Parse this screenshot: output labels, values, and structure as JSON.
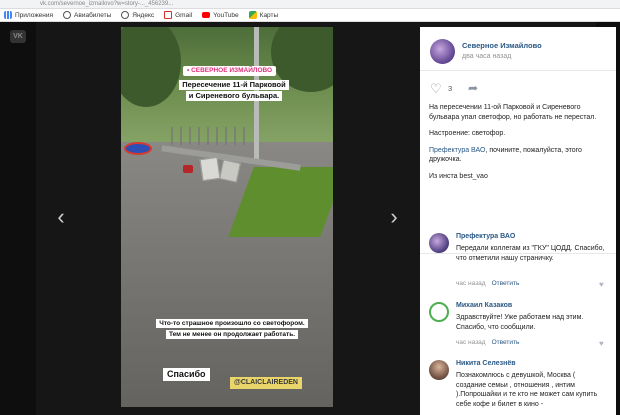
{
  "browser": {
    "url": "vk.com/severnoe_izmailovo?w=story-..._456239...",
    "bookmarks": [
      {
        "label": "Приложения",
        "icon": "apps-grid-icon",
        "color": "#4285f4"
      },
      {
        "label": "Авиабилеты",
        "icon": "globe-icon",
        "color": "#555555"
      },
      {
        "label": "Яндекс",
        "icon": "globe-icon",
        "color": "#555555"
      },
      {
        "label": "Gmail",
        "icon": "gmail-icon",
        "color": "#d93025"
      },
      {
        "label": "YouTube",
        "icon": "youtube-icon",
        "color": "#ff0000"
      },
      {
        "label": "Карты",
        "icon": "maps-icon",
        "color": "#34a853"
      }
    ]
  },
  "viewer": {
    "logo": "VK",
    "prev_arrow": "‹",
    "next_arrow": "›"
  },
  "story": {
    "tag": "• СЕВЕРНОЕ ИЗМАЙЛОВО",
    "headline_line1": "Пересечение 11-й Парковой",
    "headline_line2": "и Сиреневого бульвара.",
    "caption_line1": "Что-то страшное произошло со светофором.",
    "caption_line2": "Тем не менее он продолжает работать.",
    "thanks": "Спасибо",
    "credit": "@CLAICLAIREDEN"
  },
  "post": {
    "group_name": "Северное Измайлово",
    "time": "два часа назад",
    "likes": "3",
    "paragraph1": "На пересечении 11-ой Парковой и Сиреневого бульвара упал светофор, но работать не перестал.",
    "paragraph2": "Настроение: светофор.",
    "paragraph3_link": "Префектура ВАО",
    "paragraph3_rest": ", почините, пожалуйста, этого дружочка.",
    "paragraph4": "Из инста best_vao"
  },
  "comments": [
    {
      "author": "Префектура ВАО",
      "text": "Передали коллегам из \"ГКУ\" ЦОДД. Спасибо, что отметили нашу страничку.",
      "time": "час назад",
      "reply": "Ответить"
    },
    {
      "author": "Михаил Казаков",
      "text": "Здравствуйте! Уже работаем над этим. Спасибо, что сообщили.",
      "time": "час назад",
      "reply": "Ответить"
    },
    {
      "author": "Никита Селезнёв",
      "text": "Познакомлюсь с девушкой, Москва ( создание семьи , отношения , интим ).Попрошайки и те кто не может сам купить себе кофе и билет в кино -",
      "time": "",
      "reply": ""
    }
  ],
  "colors": {
    "link": "#2a5885",
    "backdrop": "#161616",
    "tag": "#e0307a"
  }
}
